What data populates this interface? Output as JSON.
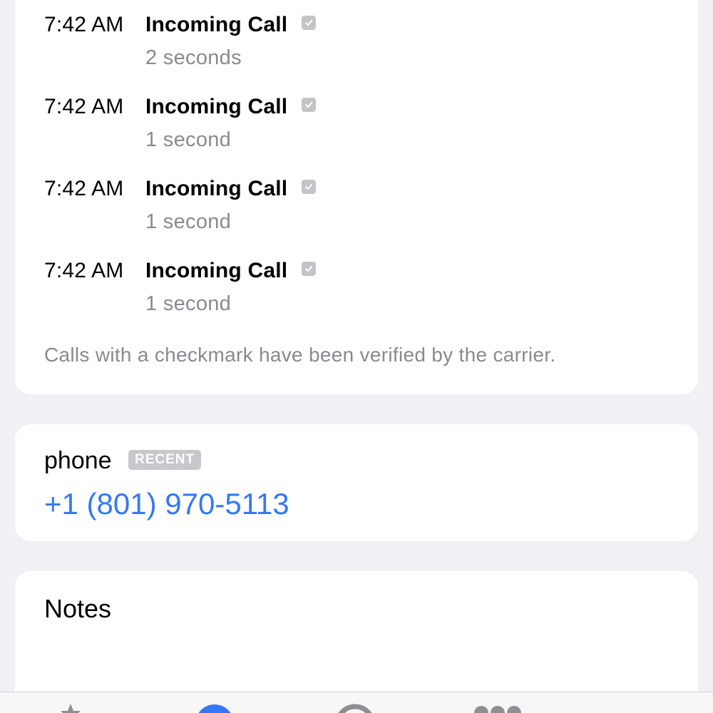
{
  "calls": [
    {
      "time": "7:42 AM",
      "type": "Incoming Call",
      "duration": "2 seconds"
    },
    {
      "time": "7:42 AM",
      "type": "Incoming Call",
      "duration": "1 second"
    },
    {
      "time": "7:42 AM",
      "type": "Incoming Call",
      "duration": "1 second"
    },
    {
      "time": "7:42 AM",
      "type": "Incoming Call",
      "duration": "1 second"
    }
  ],
  "footnote": "Calls with a checkmark have been verified by the carrier.",
  "phone": {
    "label": "phone",
    "badge": "RECENT",
    "number": "+1 (801) 970-5113"
  },
  "notes": {
    "label": "Notes"
  },
  "tabbar": {
    "icons": [
      "favorites-icon",
      "recents-icon",
      "contacts-icon",
      "keypad-icon"
    ]
  },
  "colors": {
    "background": "#f1f1f5",
    "accent": "#3478f6",
    "secondary_text": "#8a8a8e",
    "badge": "#c7c7cc"
  }
}
